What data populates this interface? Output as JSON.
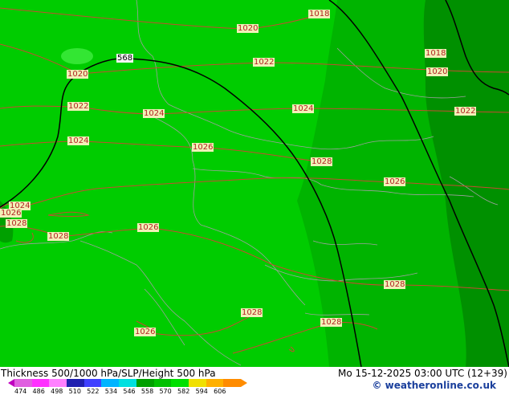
{
  "map": {
    "pressure_labels": [
      "1018",
      "1020",
      "1020",
      "1022",
      "1024",
      "1022",
      "1024",
      "1024",
      "1026",
      "1028",
      "1026",
      "1026",
      "1024",
      "1026",
      "1028",
      "1028",
      "1018",
      "1020",
      "1022",
      "1026",
      "1028",
      "1028",
      "1028",
      "1026"
    ],
    "height_label": "568",
    "colors": {
      "thickness_light": "#00cc00",
      "thickness_mid": "#00b400",
      "thickness_dark": "#009000",
      "slp_isobar": "#c84b32",
      "height_contour": "#000000",
      "borders": "#a0a0a0"
    }
  },
  "footer": {
    "title": "Thickness 500/1000 hPa/SLP/Height 500 hPa",
    "datetime": "Mo 15-12-2025 03:00 UTC (12+39)",
    "credit": "© weatheronline.co.uk"
  },
  "scale": {
    "ticks": [
      "474",
      "486",
      "498",
      "510",
      "522",
      "534",
      "546",
      "558",
      "570",
      "582",
      "594",
      "606"
    ],
    "colors": [
      "#e060e0",
      "#ff30ff",
      "#ff80ff",
      "#2020b0",
      "#4040ff",
      "#00b4ff",
      "#00e0e0",
      "#00a000",
      "#00c000",
      "#00e000",
      "#f0e000",
      "#ffb000",
      "#ff8c00"
    ]
  }
}
